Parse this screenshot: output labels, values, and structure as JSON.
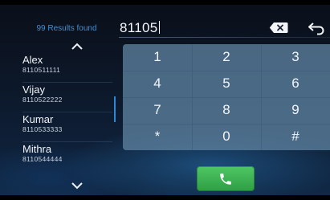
{
  "search": {
    "results_label": "99 Results found",
    "number_value": "81105"
  },
  "contacts": [
    {
      "name": "Alex",
      "number": "8110511111"
    },
    {
      "name": "Vijay",
      "number": "8110522222"
    },
    {
      "name": "Kumar",
      "number": "8110533333"
    },
    {
      "name": "Mithra",
      "number": "8110544444"
    }
  ],
  "keypad": {
    "keys": [
      "1",
      "2",
      "3",
      "4",
      "5",
      "6",
      "7",
      "8",
      "9",
      "*",
      "0",
      "#"
    ]
  },
  "icons": {
    "scroll_up": "chevron-up-icon",
    "scroll_down": "chevron-down-icon",
    "backspace": "backspace-icon",
    "back": "back-arrow-icon",
    "call": "phone-icon"
  },
  "colors": {
    "accent": "#2e86d6",
    "call": "#3db354",
    "results_text": "#3e8fd8"
  }
}
